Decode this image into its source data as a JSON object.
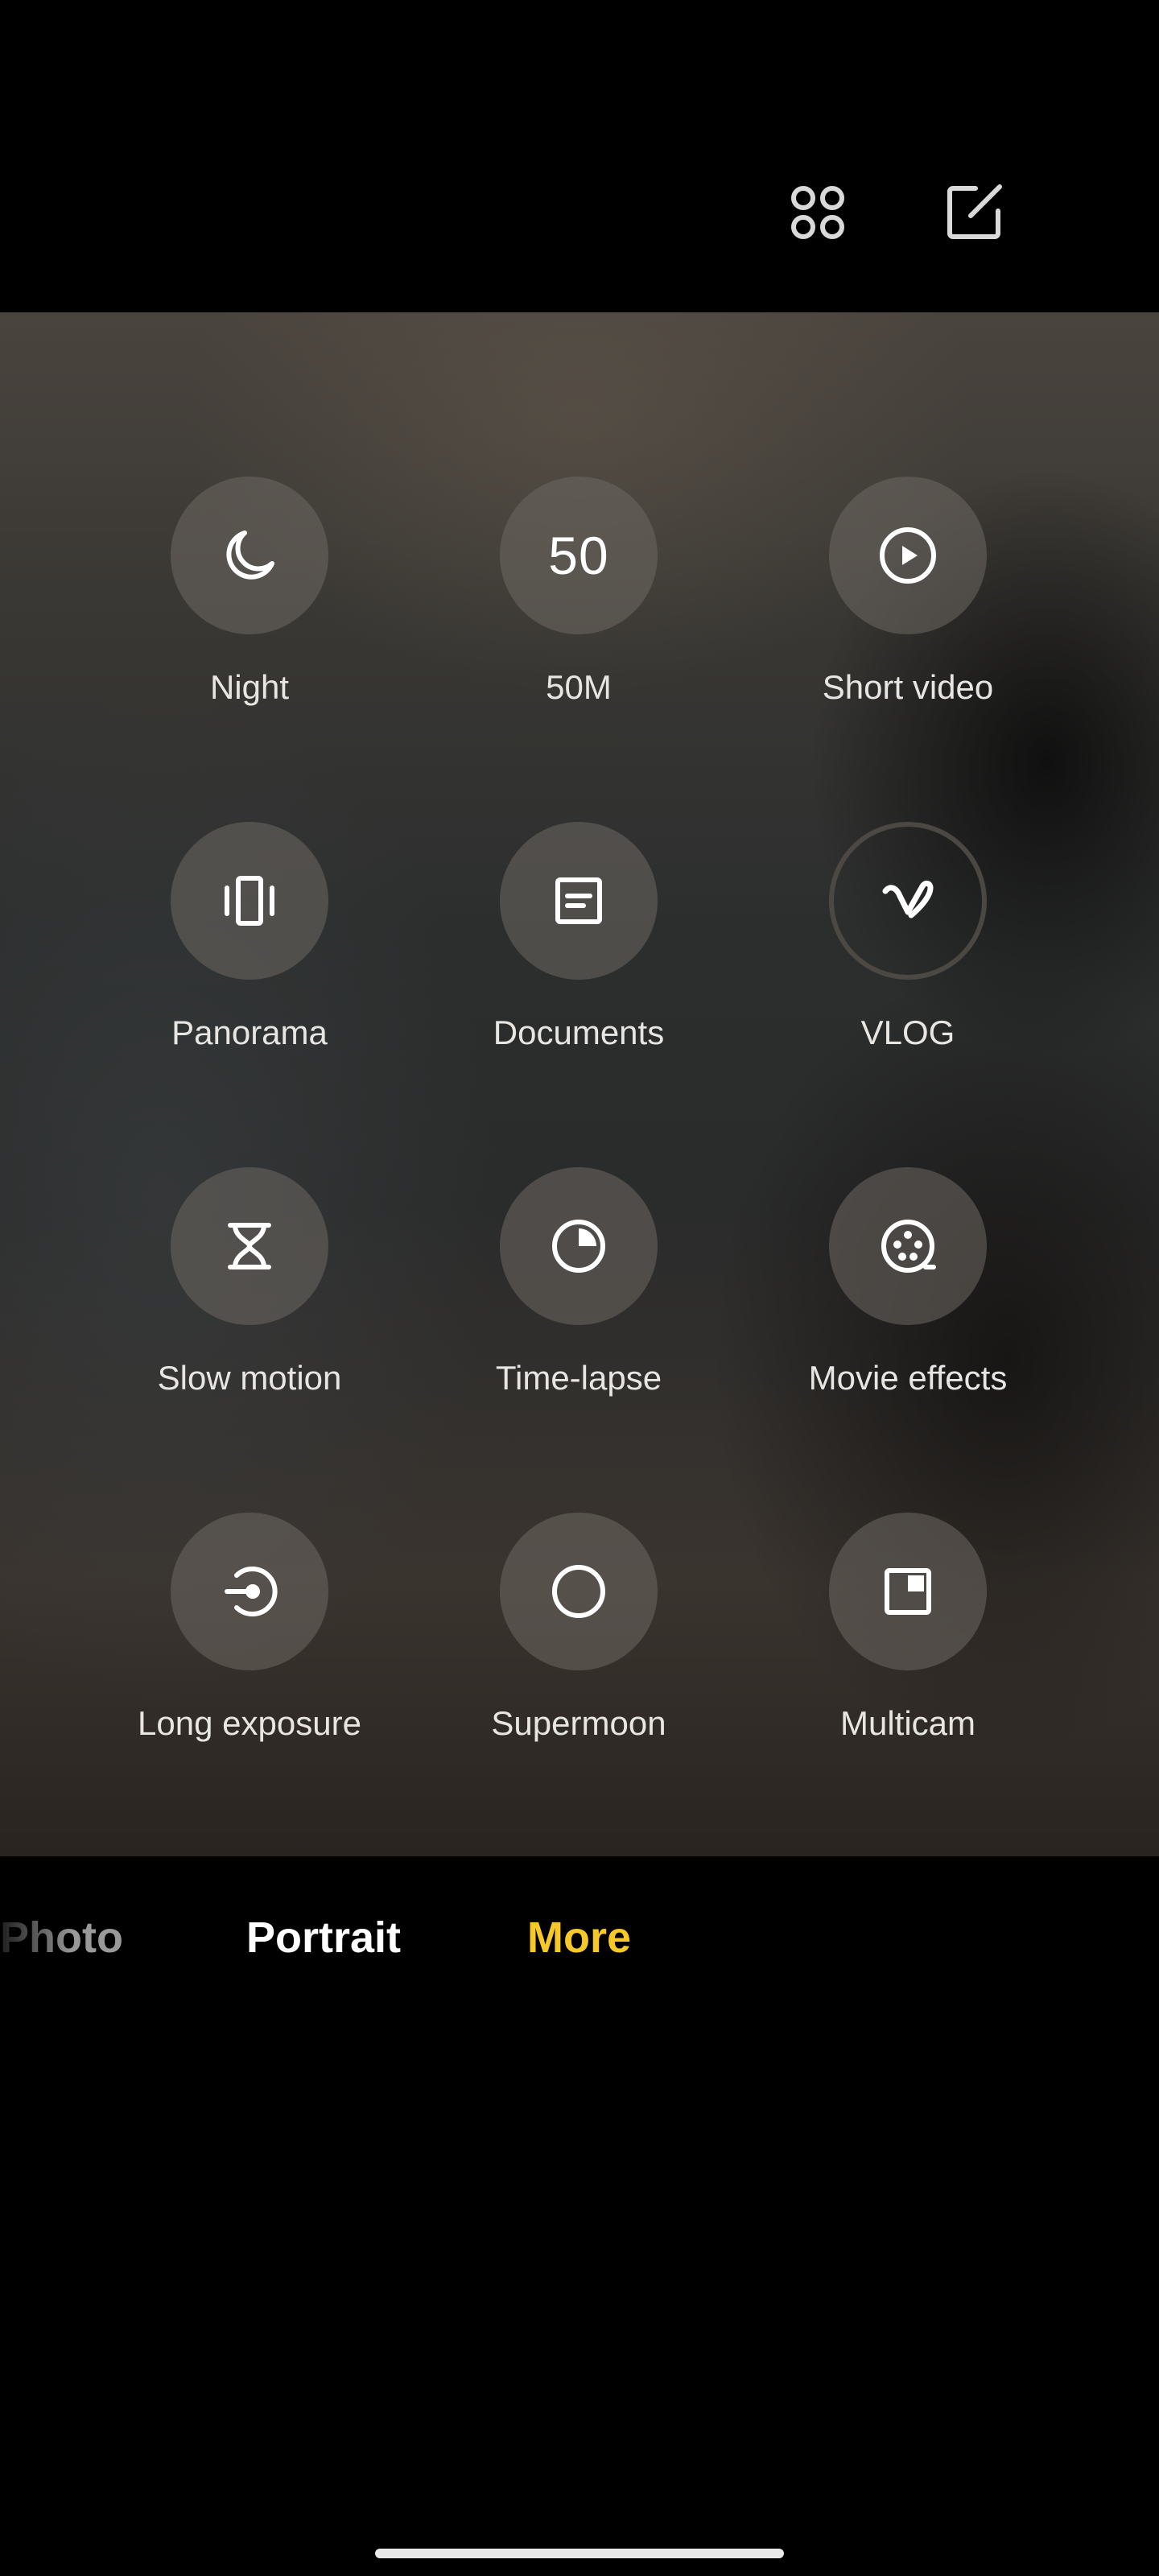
{
  "top_bar": {
    "icons": [
      "grid-apps-icon",
      "edit-icon"
    ]
  },
  "modes": [
    {
      "label": "Night",
      "icon": "moon-icon"
    },
    {
      "label": "50M",
      "icon": "text-50",
      "icon_text": "50"
    },
    {
      "label": "Short video",
      "icon": "play-circle-icon"
    },
    {
      "label": "Panorama",
      "icon": "panorama-icon"
    },
    {
      "label": "Documents",
      "icon": "document-icon"
    },
    {
      "label": "VLOG",
      "icon": "vlog-icon"
    },
    {
      "label": "Slow motion",
      "icon": "hourglass-icon"
    },
    {
      "label": "Time-lapse",
      "icon": "timelapse-icon"
    },
    {
      "label": "Movie effects",
      "icon": "film-reel-icon"
    },
    {
      "label": "Long exposure",
      "icon": "long-exposure-icon"
    },
    {
      "label": "Supermoon",
      "icon": "circle-icon"
    },
    {
      "label": "Multicam",
      "icon": "multicam-icon"
    }
  ],
  "tabs": {
    "photo": "Photo",
    "portrait": "Portrait",
    "more": "More",
    "active": "More"
  },
  "colors": {
    "active_tab": "#f6c928",
    "background": "#000000"
  }
}
